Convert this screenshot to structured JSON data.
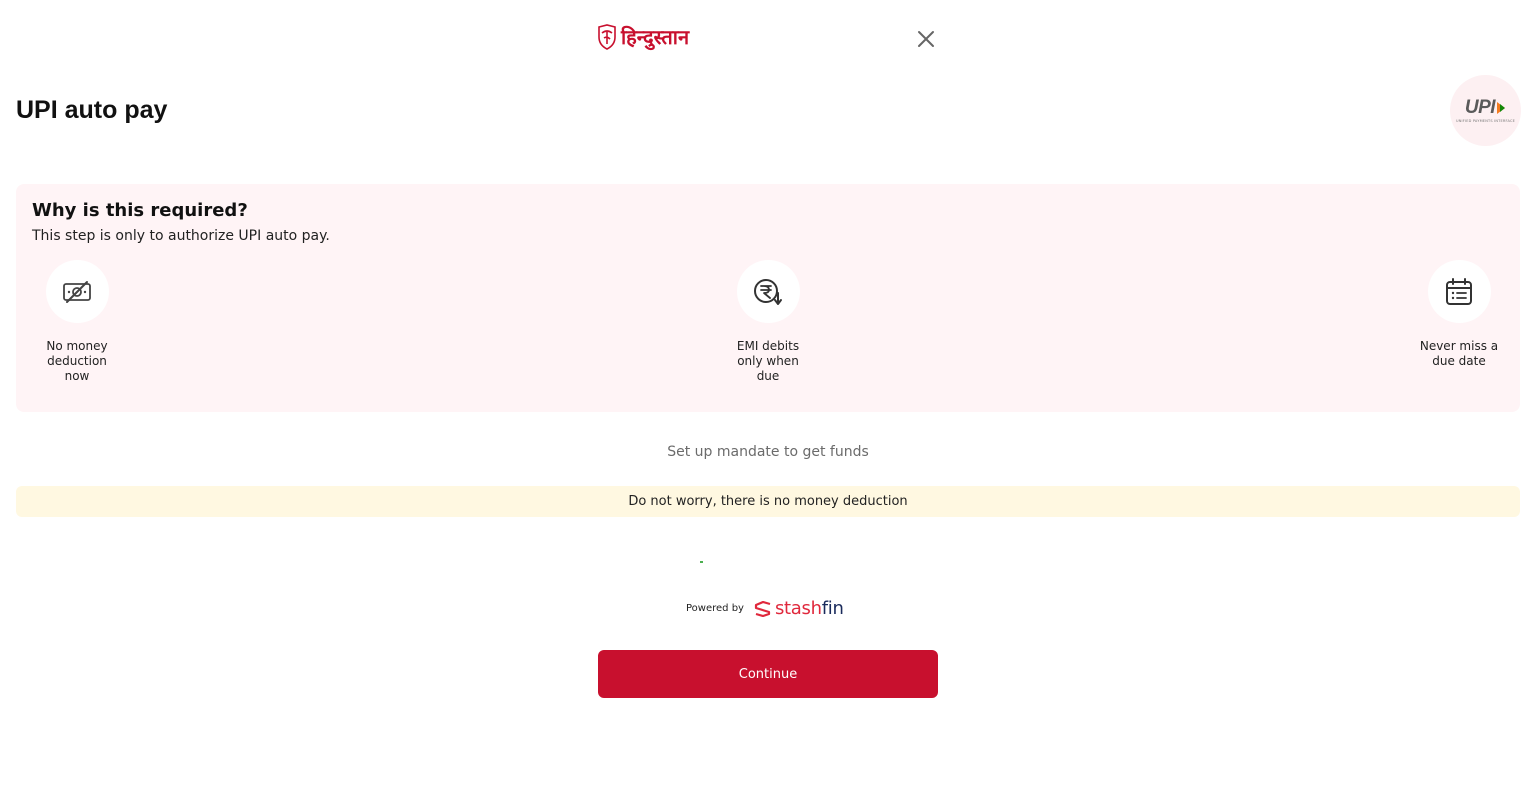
{
  "header": {
    "logo_text": "हिन्दुस्तान",
    "logo_icon": "hindustan-shield-icon",
    "close_icon": "close-icon"
  },
  "page": {
    "title": "UPI auto pay"
  },
  "upi_badge": {
    "logo_text": "UPI",
    "tagline": "UNIFIED PAYMENTS INTERFACE"
  },
  "info_card": {
    "heading": "Why is this required?",
    "subtext": "This step is only to authorize UPI auto pay.",
    "features": [
      {
        "icon": "no-money-icon",
        "label": "No money deduction now"
      },
      {
        "icon": "rupee-debit-icon",
        "label": "EMI debits only when due"
      },
      {
        "icon": "calendar-icon",
        "label": "Never miss a due date"
      }
    ]
  },
  "mandate_text": "Set up mandate to get funds",
  "notice": "Do not worry, there is no money deduction",
  "powered_by": {
    "label": "Powered by",
    "brand": "stash",
    "brand_suffix": "fin"
  },
  "continue_button": "Continue",
  "colors": {
    "primary": "#c8102e",
    "card_bg": "#fff4f6",
    "notice_bg": "#fff8e1"
  }
}
